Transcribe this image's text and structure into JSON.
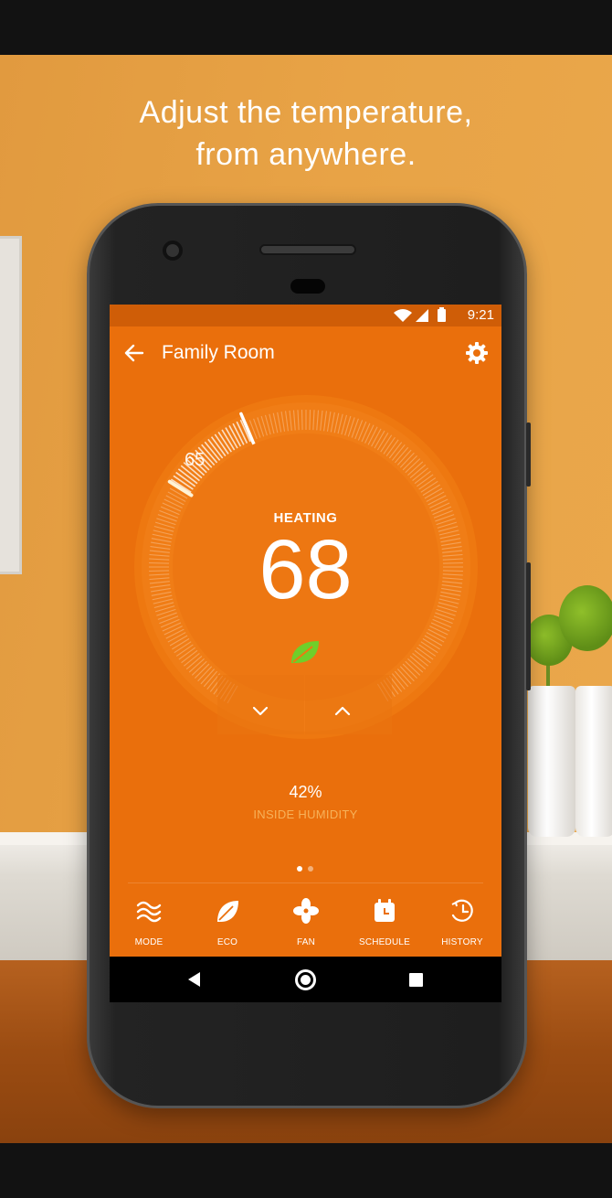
{
  "promo": {
    "tagline_line1": "Adjust the temperature,",
    "tagline_line2": "from anywhere."
  },
  "status_bar": {
    "time": "9:21",
    "icons": [
      "wifi-icon",
      "signal-icon",
      "battery-icon"
    ]
  },
  "app_bar": {
    "title": "Family Room",
    "back_icon": "arrow-back-icon",
    "settings_icon": "gear-icon"
  },
  "thermostat": {
    "mode_label": "HEATING",
    "current_temperature": "68",
    "setpoint": "65",
    "eco_icon": "leaf-icon",
    "decrease_icon": "chevron-down-icon",
    "increase_icon": "chevron-up-icon"
  },
  "humidity": {
    "value": "42%",
    "label": "INSIDE HUMIDITY"
  },
  "pager": {
    "count": 2,
    "active_index": 0
  },
  "bottom_nav": {
    "items": [
      {
        "label": "MODE",
        "icon": "waves-icon"
      },
      {
        "label": "ECO",
        "icon": "leaf-icon"
      },
      {
        "label": "FAN",
        "icon": "fan-icon"
      },
      {
        "label": "SCHEDULE",
        "icon": "calendar-clock-icon"
      },
      {
        "label": "HISTORY",
        "icon": "history-icon"
      }
    ]
  },
  "colors": {
    "screen_orange": "#ea6f0c",
    "status_orange": "#cf5d07",
    "dial_orange": "#f07d16",
    "leaf_green": "#6fcf2a",
    "humidity_label": "#f7b25a"
  }
}
